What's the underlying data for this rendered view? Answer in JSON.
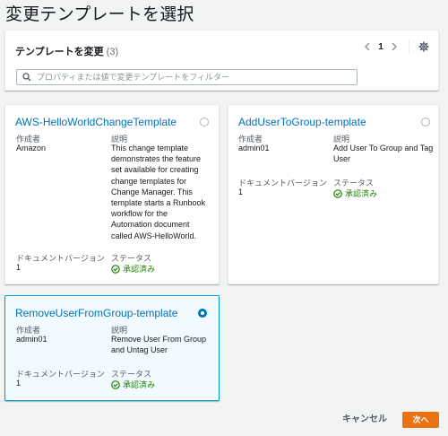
{
  "page": {
    "title": "変更テンプレートを選択"
  },
  "panel": {
    "header": "テンプレートを変更",
    "count": "(3)",
    "search_placeholder": "プロパティまたは値で変更テンプレートをフィルター",
    "page_number": "1"
  },
  "cards": [
    {
      "title": "AWS-HelloWorldChangeTemplate",
      "selected": false,
      "author_label": "作成者",
      "author": "Amazon",
      "description_label": "説明",
      "description": [
        "This change template",
        "demonstrates the feature",
        "set available for creating",
        "change templates for",
        "Change Manager. This",
        "template starts a Runbook",
        "workflow for the",
        "Automation document",
        "called AWS-HelloWorld."
      ],
      "doc_version_label": "ドキュメントバージョン",
      "doc_version": "1",
      "status_label": "ステータス",
      "status": "承認済み"
    },
    {
      "title": "AddUserToGroup-template",
      "selected": false,
      "author_label": "作成者",
      "author": "admin01",
      "description_label": "説明",
      "description": [
        "Add User To Group and Tag",
        "User"
      ],
      "doc_version_label": "ドキュメントバージョン",
      "doc_version": "1",
      "status_label": "ステータス",
      "status": "承認済み"
    },
    {
      "title": "RemoveUserFromGroup-template",
      "selected": true,
      "author_label": "作成者",
      "author": "admin01",
      "description_label": "説明",
      "description": [
        "Remove User From Group",
        "and Untag User"
      ],
      "doc_version_label": "ドキュメントバージョン",
      "doc_version": "1",
      "status_label": "ステータス",
      "status": "承認済み"
    }
  ],
  "footer": {
    "cancel": "キャンセル",
    "next": "次へ"
  },
  "colors": {
    "link": "#0073bb",
    "success": "#1d8102",
    "primary": "#ec7211",
    "selected_border": "#00a1c9"
  },
  "icons": [
    "search-icon",
    "chevron-left-icon",
    "chevron-right-icon",
    "gear-icon",
    "check-circle-icon"
  ]
}
